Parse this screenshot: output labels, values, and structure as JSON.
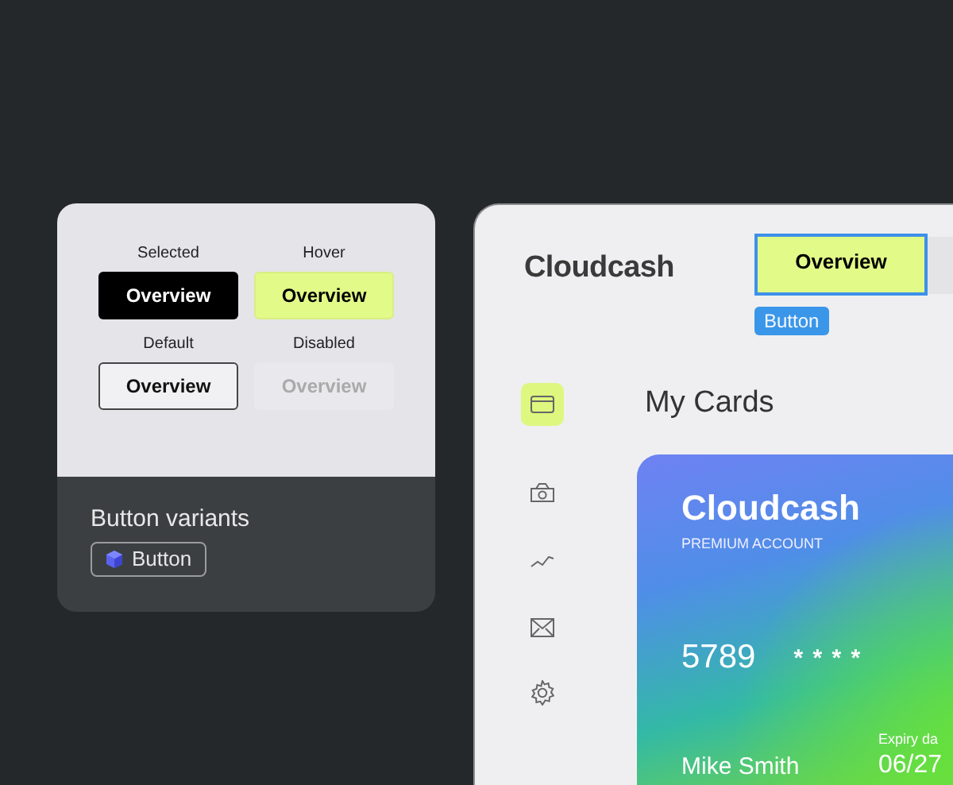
{
  "variants_card": {
    "variants": [
      {
        "label": "Selected",
        "button": "Overview",
        "kind": "selected"
      },
      {
        "label": "Hover",
        "button": "Overview",
        "kind": "hover"
      },
      {
        "label": "Default",
        "button": "Overview",
        "kind": "default"
      },
      {
        "label": "Disabled",
        "button": "Overview",
        "kind": "disabled"
      }
    ],
    "title": "Button variants",
    "tag": "Button"
  },
  "app": {
    "logo": "Cloudcash",
    "nav_button": {
      "label": "Overview",
      "kind": "hover"
    },
    "component_tag": "Button",
    "sidebar": {
      "items": [
        {
          "kind": "card",
          "selected": true
        },
        {
          "kind": "money",
          "selected": false
        },
        {
          "kind": "chart",
          "selected": false
        },
        {
          "kind": "mail",
          "selected": false
        },
        {
          "kind": "settings",
          "selected": false
        }
      ]
    },
    "heading": "My Cards",
    "card": {
      "brand": "Cloudcash",
      "tier": "PREMIUM ACCOUNT",
      "number_start": "5789",
      "number_masked": "* * * *",
      "expiry_label": "Expiry da",
      "expiry": "06/27",
      "holder": "Mike Smith"
    }
  }
}
